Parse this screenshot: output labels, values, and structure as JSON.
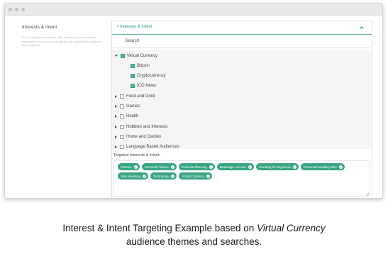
{
  "left": {
    "title": "Interests & Intent",
    "description": "Tell us about your audience, who they are, and what they're interested in. Vocabulary will use this as a guideline to target an ideal audience."
  },
  "panel": {
    "header_label": "+ Interests & Intent",
    "collapse_icon": "chevron-up-icon",
    "search_placeholder": "Search"
  },
  "tree": [
    {
      "label": "Virtual Currency",
      "level": 0,
      "expanded": true,
      "checked": true
    },
    {
      "label": "Bitcoin",
      "level": 1,
      "checked": true
    },
    {
      "label": "Cryptocurrency",
      "level": 1,
      "checked": true
    },
    {
      "label": "ICO News",
      "level": 1,
      "checked": true
    },
    {
      "label": "Food and Drink",
      "level": 0,
      "expanded": false,
      "checked": false
    },
    {
      "label": "Games",
      "level": 0,
      "expanded": false,
      "checked": false
    },
    {
      "label": "Health",
      "level": 0,
      "expanded": false,
      "checked": false
    },
    {
      "label": "Hobbies and Interests",
      "level": 0,
      "expanded": false,
      "checked": false
    },
    {
      "label": "Home and Garden",
      "level": 0,
      "expanded": false,
      "checked": false
    },
    {
      "label": "Language Based Audiences",
      "level": 0,
      "expanded": false,
      "checked": false
    }
  ],
  "targeted": {
    "label": "Targeted Interests & Intent:",
    "remove_symbol": "×",
    "chips": [
      "Finance",
      "Personal Finance",
      "Financial Planning",
      "Brokerage Account",
      "Investing for Beginners",
      "Personal Investing Sites",
      "Start Investing",
      "Technology",
      "Virtual Currency"
    ]
  },
  "caption": {
    "line1_prefix": "Interest & Intent Targeting Example based on ",
    "line1_emphasis": "Virtual Currency",
    "line2": "audience themes and searches."
  },
  "colors": {
    "accent": "#38a57e",
    "header_text": "#2f9d78",
    "tree_background": "#f5f5f5"
  }
}
